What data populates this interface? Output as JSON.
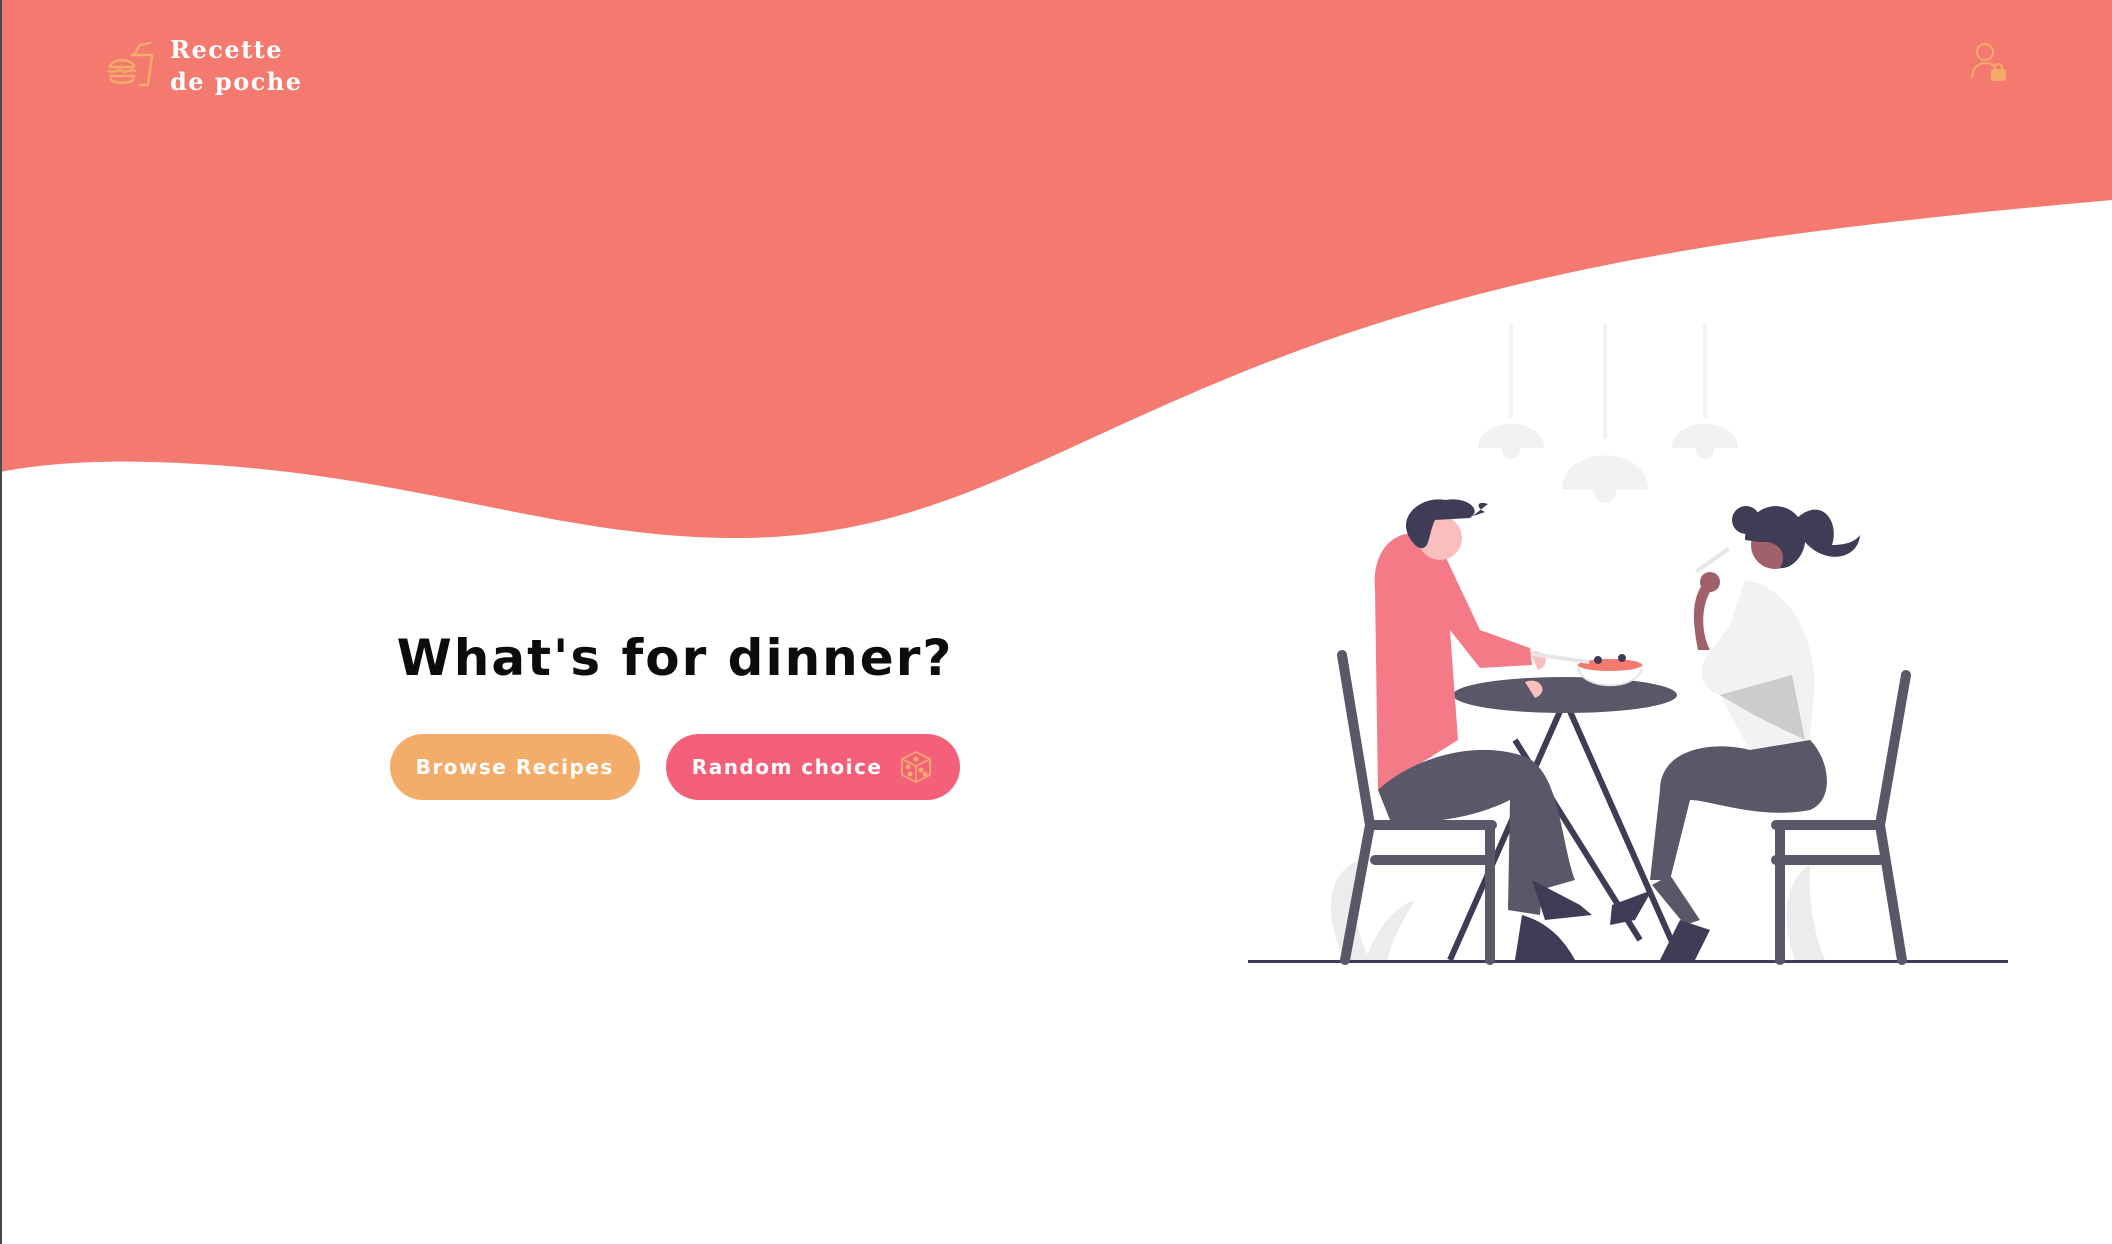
{
  "app": {
    "brand_line1": "Recette",
    "brand_line2": "de poche",
    "logo_icon": "burger-and-drink-icon",
    "user_icon": "user-lock-icon"
  },
  "hero": {
    "title": "What's for dinner?",
    "browse_label": "Browse Recipes",
    "random_label": "Random choice",
    "random_icon": "dice-icon"
  },
  "illustration": {
    "name": "couple-dining-illustration"
  },
  "colors": {
    "header_wave": "#f47a70",
    "brand_accent": "#f3ac6a",
    "browse_button": "#f3ac6a",
    "random_button": "#f4607a",
    "title_text": "#0c0c0c"
  }
}
